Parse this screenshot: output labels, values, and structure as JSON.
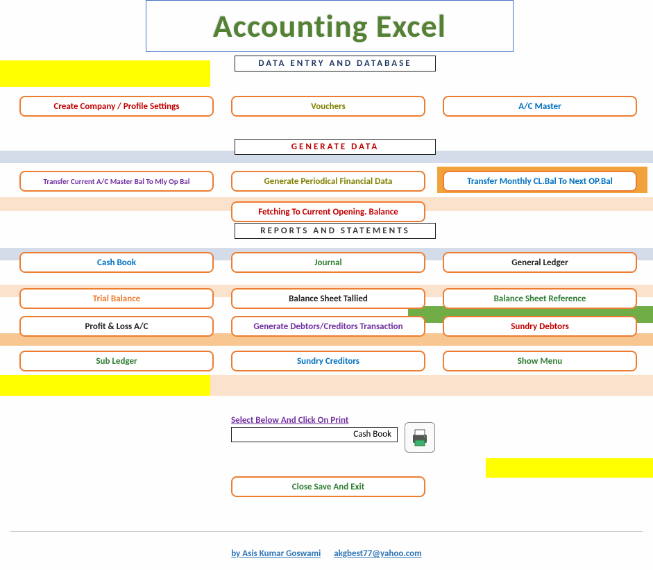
{
  "title": "Accounting Excel",
  "sections": {
    "data_entry": "DATA ENTRY AND DATABASE",
    "generate": "GENERATE  DATA",
    "reports": "REPORTS AND STATEMENTS"
  },
  "row1": {
    "create_company": "Create Company / Profile Settings",
    "vouchers": "Vouchers",
    "ac_master": "A/C  Master"
  },
  "row2": {
    "transfer_mly": "Transfer Current  A/C Master Bal  To Mly Op Bal",
    "generate_periodical": "Generate Periodical Financial Data",
    "transfer_monthly": "Transfer Monthly  CL.Bal To Next OP.Bal"
  },
  "row2b": {
    "fetching": "Fetching  To Current Opening. Balance"
  },
  "row3": {
    "cash_book": "Cash Book",
    "journal": "Journal",
    "general_ledger": "General Ledger"
  },
  "row4": {
    "trial_balance": "Trial Balance",
    "balance_sheet_tallied": "Balance Sheet Tallied",
    "balance_sheet_ref": "Balance Sheet Reference"
  },
  "row5": {
    "pl": "Profit & Loss A/C",
    "debtors_creditors": "Generate Debtors/Creditors Transaction",
    "sundry_debtors": "Sundry Debtors"
  },
  "row6": {
    "sub_ledger": "Sub Ledger",
    "sundry_creditors": "Sundry Creditors",
    "show_menu": "Show Menu"
  },
  "print": {
    "label": "Select Below And Click On Print",
    "value": "Cash Book"
  },
  "close": "Close Save And Exit",
  "footer": {
    "author": "by Asis Kumar Goswami",
    "email": "akgbest77@yahoo.com"
  },
  "colors": {
    "olive": "#808000",
    "green": "#2e7d32",
    "blue": "#0070c0",
    "dark": "#222",
    "maroon": "#c00000",
    "purple": "#7030a0",
    "orange": "#ed7d31"
  }
}
